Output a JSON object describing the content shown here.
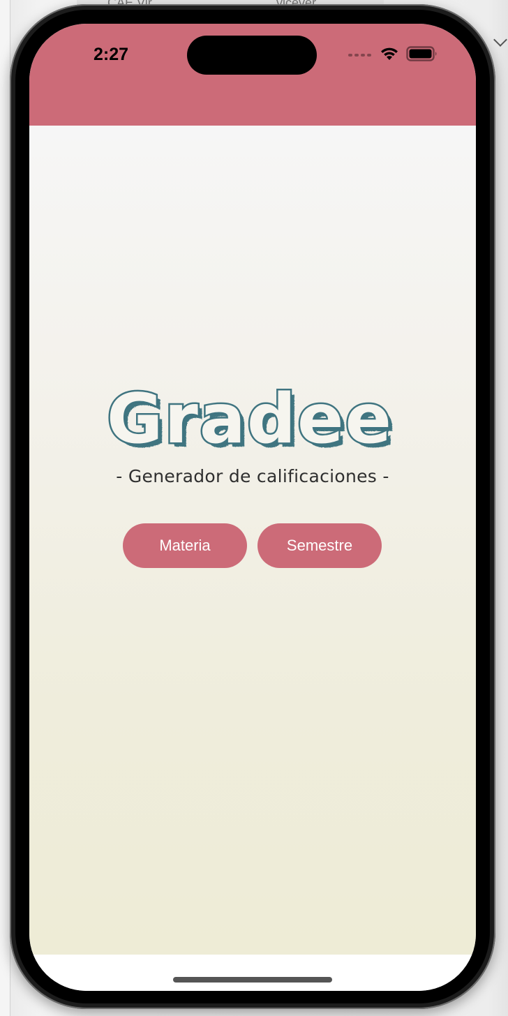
{
  "background_window": {
    "tab_left": "CAE Vir",
    "tab_right": "vicever"
  },
  "status_bar": {
    "time": "2:27"
  },
  "app": {
    "logo_text": "Gradee",
    "subtitle": "- Generador de calificaciones -",
    "buttons": {
      "materia": "Materia",
      "semestre": "Semestre"
    }
  },
  "colors": {
    "accent": "#cc6b78",
    "logo": "#3f7480",
    "button_text": "#ffffff"
  },
  "icons": [
    "wifi-icon",
    "battery-icon",
    "cellular-signal-icon"
  ]
}
